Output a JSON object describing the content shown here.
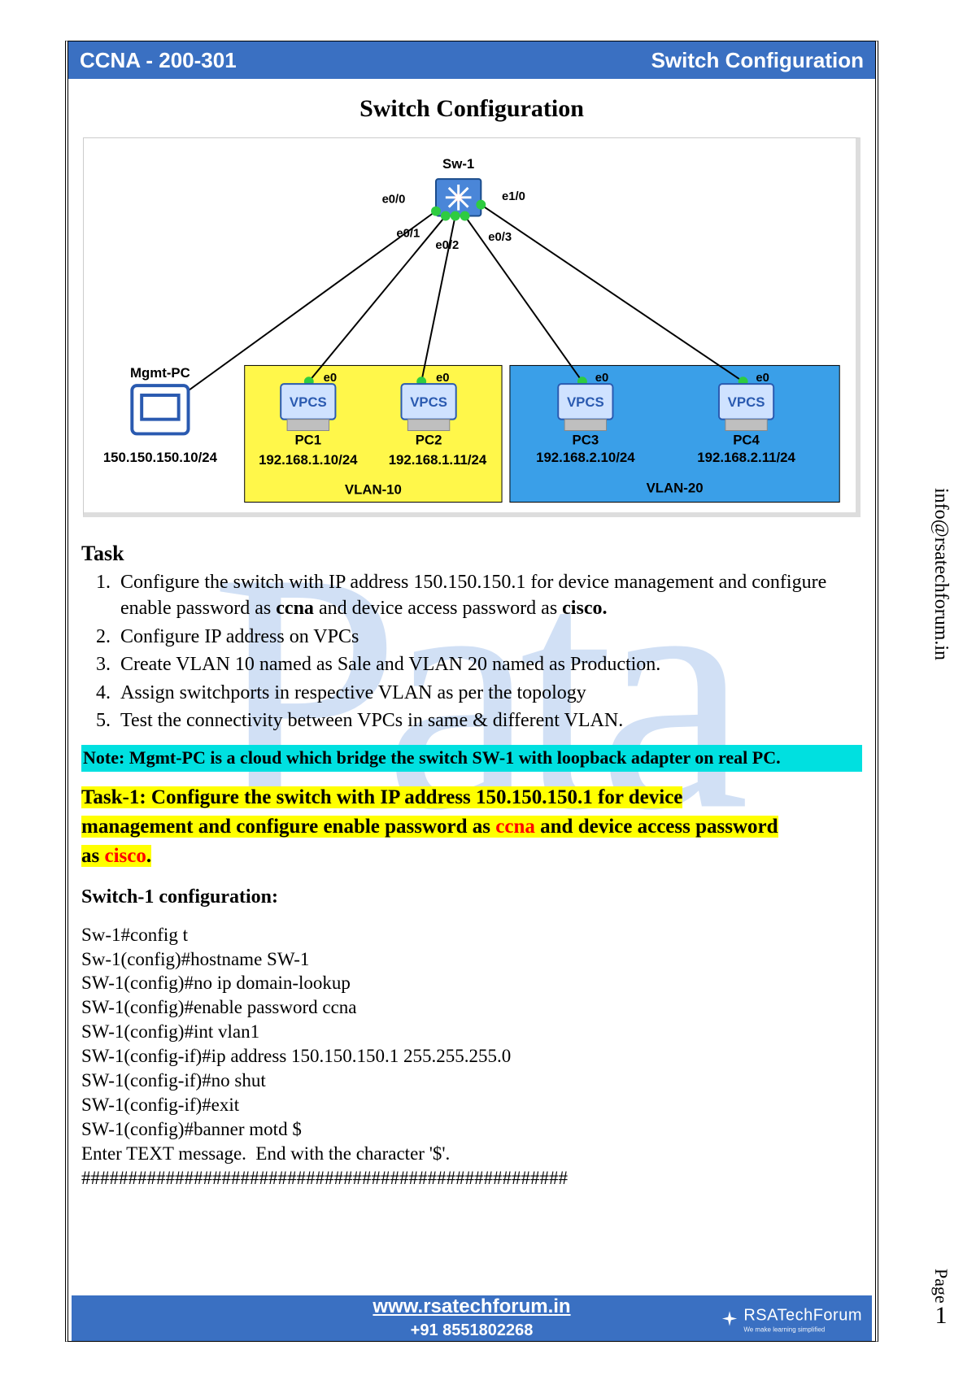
{
  "header": {
    "left": "CCNA - 200-301",
    "right": "Switch Configuration"
  },
  "title": "Switch Configuration",
  "topology": {
    "switch": {
      "name": "Sw-1",
      "ports": [
        "e0/0",
        "e0/1",
        "e0/2",
        "e0/3",
        "e1/0"
      ]
    },
    "mgmt_pc": {
      "name": "Mgmt-PC",
      "ip": "150.150.150.10/24"
    },
    "vlan10": {
      "label": "VLAN-10",
      "pcs": [
        {
          "name": "PC1",
          "port": "e0",
          "ip": "192.168.1.10/24"
        },
        {
          "name": "PC2",
          "port": "e0",
          "ip": "192.168.1.11/24"
        }
      ]
    },
    "vlan20": {
      "label": "VLAN-20",
      "pcs": [
        {
          "name": "PC3",
          "port": "e0",
          "ip": "192.168.2.10/24"
        },
        {
          "name": "PC4",
          "port": "e0",
          "ip": "192.168.2.11/24"
        }
      ]
    }
  },
  "task_heading": "Task",
  "tasks": {
    "t1a": "Configure the switch with IP address 150.150.150.1 for device management and configure enable password as ",
    "t1b": "ccna",
    "t1c": " and device access password as ",
    "t1d": "cisco.",
    "t2": "Configure IP address on VPCs",
    "t3": "Create VLAN 10 named as Sale and VLAN 20 named as Production.",
    "t4": "Assign switchports in respective VLAN as per the topology",
    "t5": "Test the connectivity between VPCs in same & different VLAN."
  },
  "note": "Note: Mgmt-PC is a cloud which bridge the switch SW-1 with loopback adapter on real PC.",
  "task1_band": {
    "p1": "Task-1: Configure the switch with IP address 150.150.150.1 for device ",
    "p2": "management and configure enable password as ",
    "p3": "ccna",
    "p4": " and device access password ",
    "p5": "as ",
    "p6": "cisco",
    "p7": "."
  },
  "subhead": "Switch-1 configuration:",
  "code": "Sw-1#config t\nSw-1(config)#hostname SW-1\nSW-1(config)#no ip domain-lookup\nSW-1(config)#enable password ccna\nSW-1(config)#int vlan1\nSW-1(config-if)#ip address 150.150.150.1 255.255.255.0\nSW-1(config-if)#no shut\nSW-1(config-if)#exit\nSW-1(config)#banner motd $\nEnter TEXT message.  End with the character '$'.\n####################################################",
  "footer": {
    "url": "www.rsatechforum.in",
    "phone": "+91 8551802268",
    "brand": "RSATechForum",
    "tag": "We make learning simplified"
  },
  "side": {
    "email": "info@rsatechforum.in",
    "page_label": "Page",
    "page_num": "1"
  },
  "vpcs_label": "VPCS"
}
